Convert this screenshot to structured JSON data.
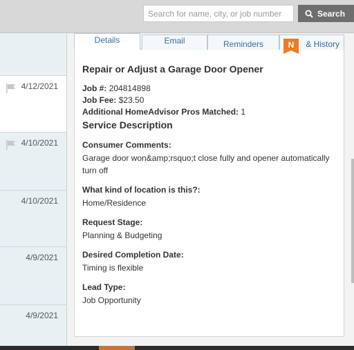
{
  "search": {
    "placeholder": "Search for name, city, or job number",
    "button_label": "Search"
  },
  "leads": [
    {
      "date": "4/12/2021",
      "flag": true
    },
    {
      "date": "4/10/2021",
      "flag": true
    },
    {
      "date": "4/10/2021",
      "flag": false
    },
    {
      "date": "4/9/2021",
      "flag": false
    },
    {
      "date": "4/9/2021",
      "flag": false
    }
  ],
  "tabs": {
    "details": "Details",
    "email": "Email",
    "reminders": "Reminders",
    "history": "& History",
    "badge": "N"
  },
  "detail": {
    "title": "Repair or Adjust a Garage Door Opener",
    "job_number_label": "Job #:",
    "job_number": "204814898",
    "job_fee_label": "Job Fee:",
    "job_fee": "$23.50",
    "pros_matched_label": "Additional HomeAdvisor Pros Matched:",
    "pros_matched": "1",
    "service_description_title": "Service Description",
    "fields": [
      {
        "label": "Consumer Comments:",
        "value": "Garage door won&amp;rsquo;t close fully and opener automatically turn off"
      },
      {
        "label": "What kind of location is this?:",
        "value": "Home/Residence"
      },
      {
        "label": "Request Stage:",
        "value": "Planning & Budgeting"
      },
      {
        "label": "Desired Completion Date:",
        "value": "Timing is flexible"
      },
      {
        "label": "Lead Type:",
        "value": "Job Opportunity"
      }
    ]
  },
  "colors": {
    "accent_orange": "#ee7a21",
    "tab_text": "#3a6f98",
    "search_button": "#6e6e6e"
  }
}
